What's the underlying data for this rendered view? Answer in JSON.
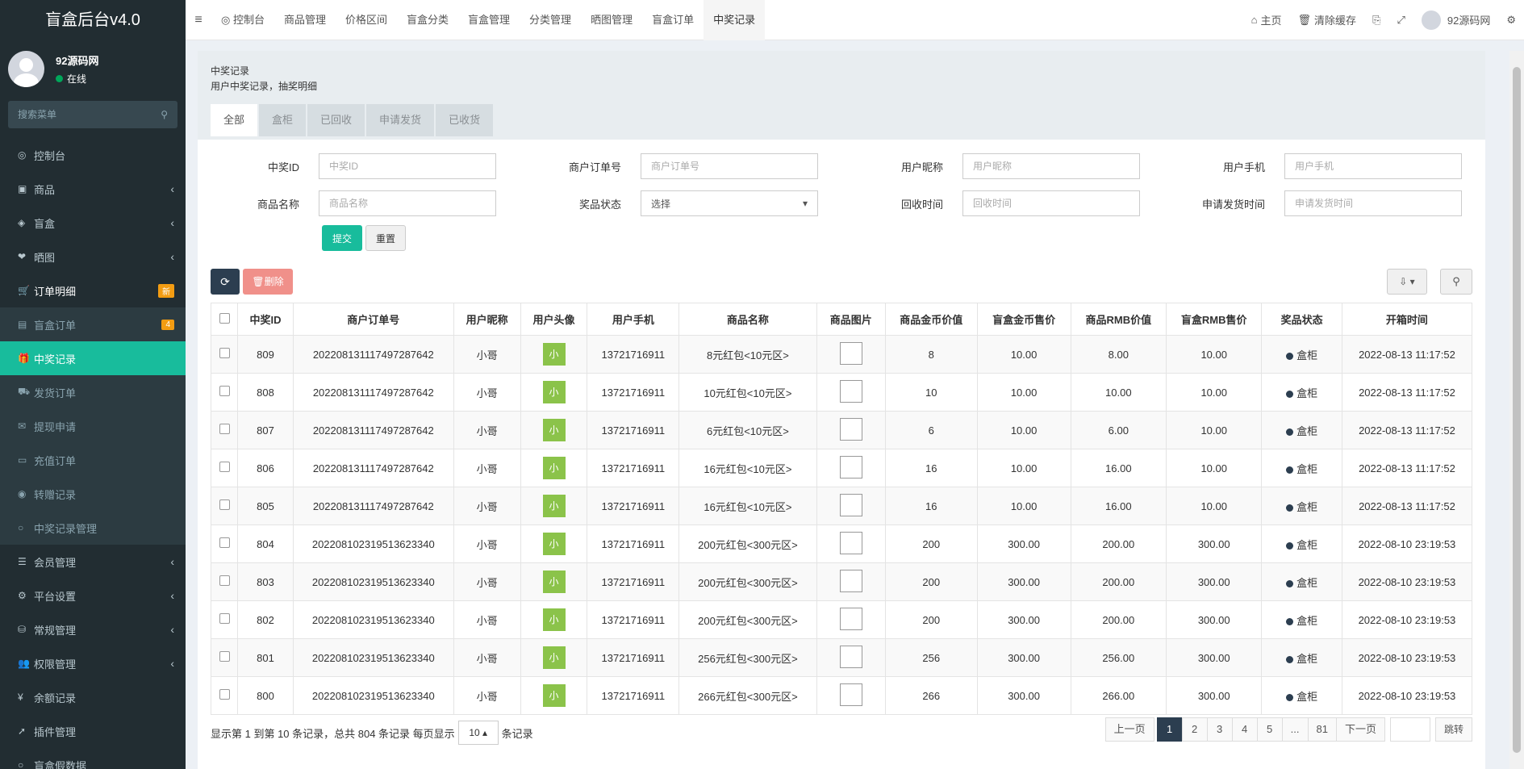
{
  "app": {
    "title": "盲盒后台v4.0"
  },
  "user": {
    "name": "92源码网",
    "status": "在线"
  },
  "sidebar": {
    "search_placeholder": "搜索菜单",
    "items": [
      {
        "label": "控制台",
        "icon": "dashboard-icon",
        "glyph": "◎"
      },
      {
        "label": "商品",
        "icon": "shopping-bag-icon",
        "glyph": "▣"
      },
      {
        "label": "盲盒",
        "icon": "cube-icon",
        "glyph": "◈"
      },
      {
        "label": "晒图",
        "icon": "heart-icon",
        "glyph": "❤"
      },
      {
        "label": "订单明细",
        "icon": "cart-icon",
        "glyph": "🛒"
      },
      {
        "label": "盲盒订单",
        "icon": "calendar-icon",
        "glyph": "▤",
        "badge": "4"
      },
      {
        "label": "中奖记录",
        "icon": "gift-icon",
        "glyph": "🎁"
      },
      {
        "label": "发货订单",
        "icon": "truck-icon",
        "glyph": "⛟"
      },
      {
        "label": "提现申请",
        "icon": "comments-icon",
        "glyph": "✉"
      },
      {
        "label": "充值订单",
        "icon": "list-alt-icon",
        "glyph": "▭"
      },
      {
        "label": "转赠记录",
        "icon": "eye-icon",
        "glyph": "◉"
      },
      {
        "label": "中奖记录管理",
        "icon": "circle-icon",
        "glyph": "○"
      },
      {
        "label": "会员管理",
        "icon": "list-icon",
        "glyph": "☰"
      },
      {
        "label": "平台设置",
        "icon": "cog-icon",
        "glyph": "⚙"
      },
      {
        "label": "常规管理",
        "icon": "database-icon",
        "glyph": "⛁"
      },
      {
        "label": "权限管理",
        "icon": "group-icon",
        "glyph": "👥"
      },
      {
        "label": "余额记录",
        "icon": "yen-icon",
        "glyph": "¥"
      },
      {
        "label": "插件管理",
        "icon": "rocket-icon",
        "glyph": "➚"
      },
      {
        "label": "盲盒假数据",
        "icon": "circle-icon",
        "glyph": "○"
      }
    ],
    "badge_new": "新"
  },
  "topnav": {
    "tabs": [
      "控制台",
      "商品管理",
      "价格区间",
      "盲盒分类",
      "盲盒管理",
      "分类管理",
      "晒图管理",
      "盲盒订单",
      "中奖记录"
    ],
    "home": "主页",
    "clear_cache": "清除缓存",
    "username": "92源码网"
  },
  "page": {
    "title": "中奖记录",
    "description": "用户中奖记录，抽奖明细",
    "tabs": [
      "全部",
      "盒柜",
      "已回收",
      "申请发货",
      "已收货"
    ]
  },
  "filters": {
    "row1": [
      {
        "label": "中奖ID",
        "placeholder": "中奖ID"
      },
      {
        "label": "商户订单号",
        "placeholder": "商户订单号"
      },
      {
        "label": "用户昵称",
        "placeholder": "用户昵称"
      },
      {
        "label": "用户手机",
        "placeholder": "用户手机"
      }
    ],
    "row2": [
      {
        "label": "商品名称",
        "placeholder": "商品名称"
      },
      {
        "label": "奖品状态",
        "select_value": "选择"
      },
      {
        "label": "回收时间",
        "placeholder": "回收时间"
      },
      {
        "label": "申请发货时间",
        "placeholder": "申请发货时间"
      }
    ],
    "submit": "提交",
    "reset": "重置"
  },
  "toolbar": {
    "delete": "删除"
  },
  "table": {
    "headers": [
      "中奖ID",
      "商户订单号",
      "用户昵称",
      "用户头像",
      "用户手机",
      "商品名称",
      "商品图片",
      "商品金币价值",
      "盲盒金币售价",
      "商品RMB价值",
      "盲盒RMB售价",
      "奖品状态",
      "开箱时间"
    ],
    "rows": [
      {
        "id": "809",
        "order": "2022081311174972876​42",
        "nick": "小哥",
        "avatar": "小",
        "phone": "13721716911",
        "product": "8元红包<10元区>",
        "coin_value": "8",
        "box_coin": "10.00",
        "rmb_value": "8.00",
        "box_rmb": "10.00",
        "status": "盒柜",
        "time": "2022-08-13 11:17:52"
      },
      {
        "id": "808",
        "order": "20220813111749728764​2",
        "nick": "小哥",
        "avatar": "小",
        "phone": "13721716911",
        "product": "10元红包<10元区>",
        "coin_value": "10",
        "box_coin": "10.00",
        "rmb_value": "10.00",
        "box_rmb": "10.00",
        "status": "盒柜",
        "time": "2022-08-13 11:17:52"
      },
      {
        "id": "807",
        "order": "202208131117497287642",
        "nick": "小哥",
        "avatar": "小",
        "phone": "13721716911",
        "product": "6元红包<10元区>",
        "coin_value": "6",
        "box_coin": "10.00",
        "rmb_value": "6.00",
        "box_rmb": "10.00",
        "status": "盒柜",
        "time": "2022-08-13 11:17:52"
      },
      {
        "id": "806",
        "order": "202208131117497287642",
        "nick": "小哥",
        "avatar": "小",
        "phone": "13721716911",
        "product": "16元红包<10元区>",
        "coin_value": "16",
        "box_coin": "10.00",
        "rmb_value": "16.00",
        "box_rmb": "10.00",
        "status": "盒柜",
        "time": "2022-08-13 11:17:52"
      },
      {
        "id": "805",
        "order": "202208131117497287642",
        "nick": "小哥",
        "avatar": "小",
        "phone": "13721716911",
        "product": "16元红包<10元区>",
        "coin_value": "16",
        "box_coin": "10.00",
        "rmb_value": "16.00",
        "box_rmb": "10.00",
        "status": "盒柜",
        "time": "2022-08-13 11:17:52"
      },
      {
        "id": "804",
        "order": "202208102319513623340",
        "nick": "小哥",
        "avatar": "小",
        "phone": "13721716911",
        "product": "200元红包<300元区>",
        "coin_value": "200",
        "box_coin": "300.00",
        "rmb_value": "200.00",
        "box_rmb": "300.00",
        "status": "盒柜",
        "time": "2022-08-10 23:19:53"
      },
      {
        "id": "803",
        "order": "202208102319513623340",
        "nick": "小哥",
        "avatar": "小",
        "phone": "13721716911",
        "product": "200元红包<300元区>",
        "coin_value": "200",
        "box_coin": "300.00",
        "rmb_value": "200.00",
        "box_rmb": "300.00",
        "status": "盒柜",
        "time": "2022-08-10 23:19:53"
      },
      {
        "id": "802",
        "order": "202208102319513623340",
        "nick": "小哥",
        "avatar": "小",
        "phone": "13721716911",
        "product": "200元红包<300元区>",
        "coin_value": "200",
        "box_coin": "300.00",
        "rmb_value": "200.00",
        "box_rmb": "300.00",
        "status": "盒柜",
        "time": "2022-08-10 23:19:53"
      },
      {
        "id": "801",
        "order": "202208102319513623340",
        "nick": "小哥",
        "avatar": "小",
        "phone": "13721716911",
        "product": "256元红包<300元区>",
        "coin_value": "256",
        "box_coin": "300.00",
        "rmb_value": "256.00",
        "box_rmb": "300.00",
        "status": "盒柜",
        "time": "2022-08-10 23:19:53"
      },
      {
        "id": "800",
        "order": "202208102319513623340",
        "nick": "小哥",
        "avatar": "小",
        "phone": "13721716911",
        "product": "266元红包<300元区>",
        "coin_value": "266",
        "box_coin": "300.00",
        "rmb_value": "266.00",
        "box_rmb": "300.00",
        "status": "盒柜",
        "time": "2022-08-10 23:19:53"
      }
    ]
  },
  "pagination": {
    "summary_prefix": "显示第 1 到第 10 条记录，总共 804 条记录 每页显示",
    "page_size": "10",
    "summary_suffix": "条记录",
    "prev": "上一页",
    "pages": [
      "1",
      "2",
      "3",
      "4",
      "5",
      "...",
      "81"
    ],
    "current": "1",
    "next": "下一页",
    "go": "跳转"
  },
  "colors": {
    "accent": "#18bc9c",
    "sidebar_bg": "#222d32",
    "dark": "#2c3e50",
    "danger": "#f0908a"
  }
}
